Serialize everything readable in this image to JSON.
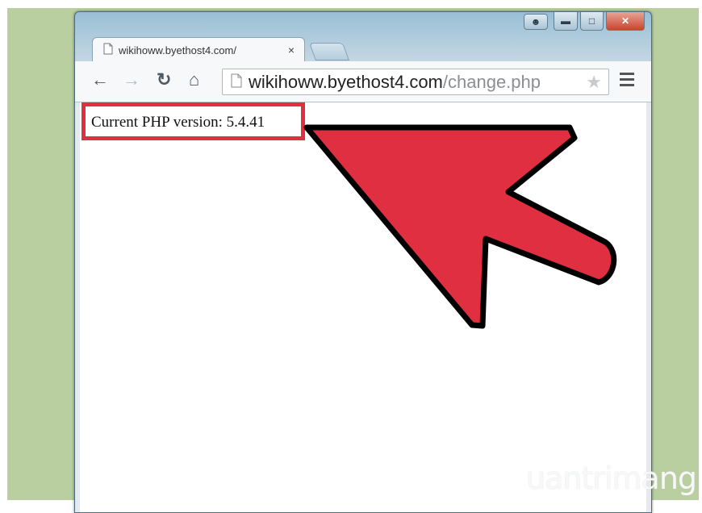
{
  "browser": {
    "tab": {
      "title": "wikihoww.byethost4.com/",
      "close_glyph": "×"
    },
    "window_buttons": [
      "user-icon",
      "minimize-icon",
      "maximize-icon",
      "close-icon"
    ],
    "nav_icons": [
      "back-icon",
      "forward-icon",
      "reload-icon",
      "home-icon"
    ],
    "address": {
      "host": "wikihoww.byethost4.com",
      "path": "/change.php"
    },
    "star_icon": "star-icon",
    "menu_icon": "menu-icon"
  },
  "page": {
    "php_version_text": "Current PHP version: 5.4.41"
  },
  "annotation": {
    "highlight_color": "#e02f41",
    "arrow_color": "#e02f41"
  },
  "watermark": {
    "text": "uantrimang"
  }
}
